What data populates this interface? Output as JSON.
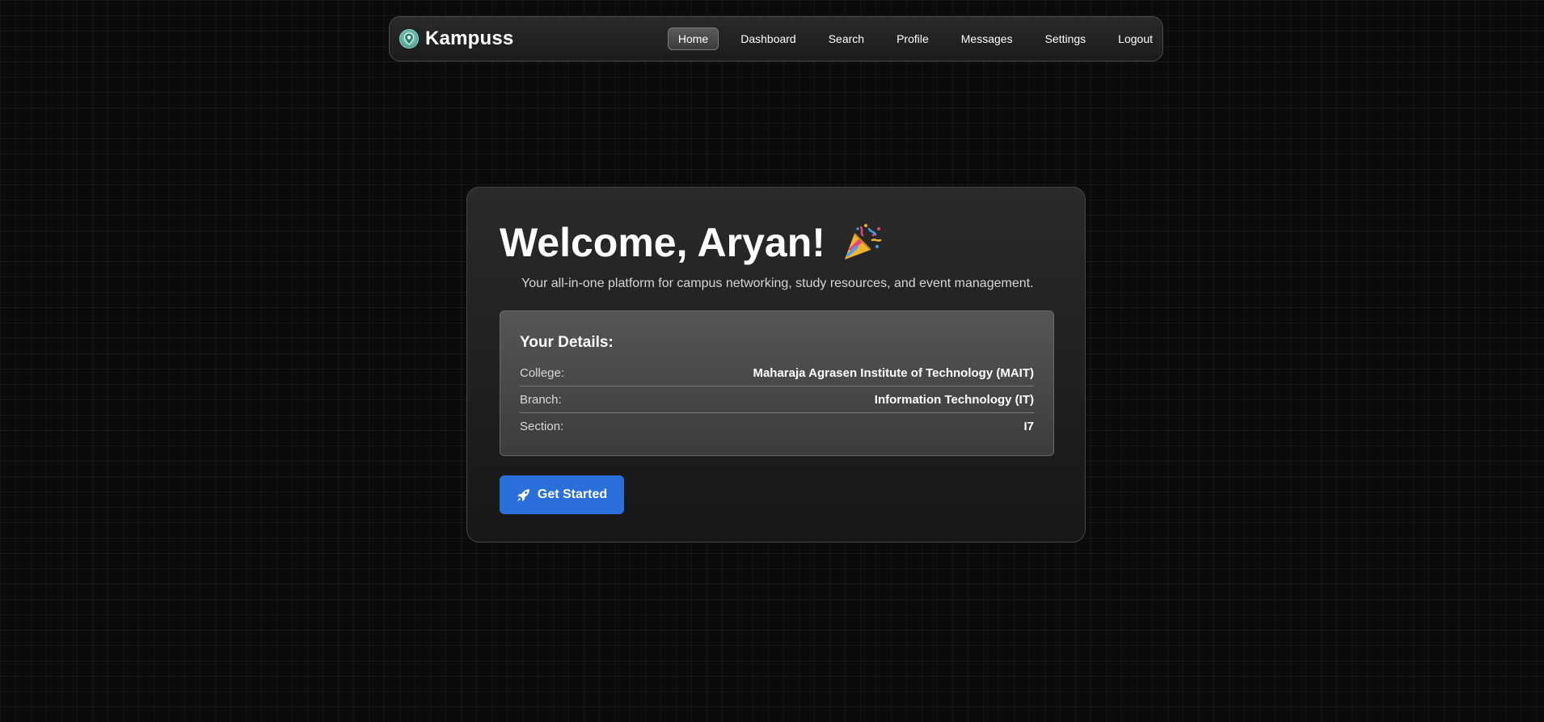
{
  "app": {
    "name": "Kampuss",
    "logo_icon": "map-pin-globe-icon"
  },
  "nav": {
    "items": [
      {
        "label": "Home",
        "active": true
      },
      {
        "label": "Dashboard",
        "active": false
      },
      {
        "label": "Search",
        "active": false
      },
      {
        "label": "Profile",
        "active": false
      },
      {
        "label": "Messages",
        "active": false
      },
      {
        "label": "Settings",
        "active": false
      },
      {
        "label": "Logout",
        "active": false
      }
    ]
  },
  "welcome": {
    "title": "Welcome, Aryan!",
    "emoji_icon": "party-popper-icon",
    "subtitle": "Your all-in-one platform for campus networking, study resources, and event management."
  },
  "details": {
    "heading": "Your Details:",
    "rows": [
      {
        "label": "College:",
        "value": "Maharaja Agrasen Institute of Technology (MAIT)"
      },
      {
        "label": "Branch:",
        "value": "Information Technology (IT)"
      },
      {
        "label": "Section:",
        "value": "I7"
      }
    ]
  },
  "cta": {
    "label": "Get Started",
    "icon": "rocket-icon"
  },
  "colors": {
    "background": "#0b0b0b",
    "accent": "#2b6fdb",
    "card": "#232323",
    "text": "#ffffff"
  }
}
